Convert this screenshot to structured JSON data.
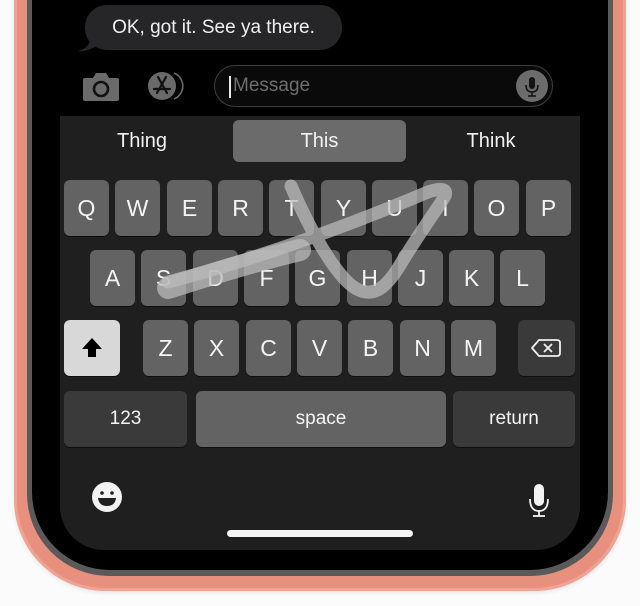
{
  "conversation": {
    "received_message": "OK, got it. See ya there."
  },
  "composer": {
    "camera_icon": "camera-icon",
    "app_store_icon": "app-store-icon",
    "message_placeholder": "Message",
    "dictation_icon": "microphone-icon"
  },
  "suggestions": [
    {
      "label": "Thing",
      "selected": false
    },
    {
      "label": "This",
      "selected": true
    },
    {
      "label": "Think",
      "selected": false
    }
  ],
  "keyboard": {
    "row1": [
      "Q",
      "W",
      "E",
      "R",
      "T",
      "Y",
      "U",
      "I",
      "O",
      "P"
    ],
    "row2": [
      "A",
      "S",
      "D",
      "F",
      "G",
      "H",
      "J",
      "K",
      "L"
    ],
    "row3": [
      "Z",
      "X",
      "C",
      "V",
      "B",
      "N",
      "M"
    ],
    "shift_icon": "shift-arrow-icon",
    "delete_icon": "delete-backspace-icon",
    "numbers_label": "123",
    "space_label": "space",
    "return_label": "return",
    "emoji_icon": "emoji-smiley-icon",
    "dictation_icon": "microphone-icon",
    "swipe_word_keys": [
      "T",
      "G",
      "H",
      "U",
      "I",
      "S"
    ]
  },
  "colors": {
    "case": "#e8907e",
    "keyboard_bg": "#1f1f1f",
    "key": "#636363",
    "key_dark": "#3a3a3a",
    "shift_active": "#d8d8d8",
    "swipe_trail": "#b8b8b8"
  }
}
